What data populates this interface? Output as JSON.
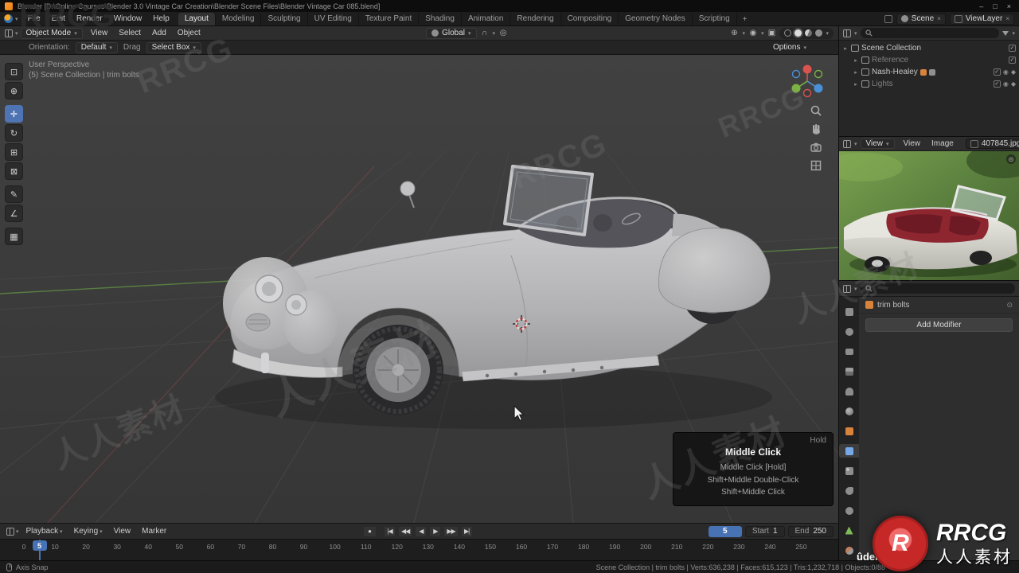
{
  "titlebar": {
    "title": "Blender [D:\\Online Courses\\Blender 3.0 Vintage Car Creation\\Blender Scene Files\\Blender Vintage Car 085.blend]",
    "minimize": "–",
    "maximize": "□",
    "close": "×"
  },
  "menubar": {
    "menus": [
      "File",
      "Edit",
      "Render",
      "Window",
      "Help"
    ],
    "workspaces": [
      "Layout",
      "Modeling",
      "Sculpting",
      "UV Editing",
      "Texture Paint",
      "Shading",
      "Animation",
      "Rendering",
      "Compositing",
      "Geometry Nodes",
      "Scripting"
    ],
    "active_workspace": "Layout",
    "new_workspace": "+",
    "scene_label": "Scene",
    "viewlayer_label": "ViewLayer",
    "unlink": "×"
  },
  "viewport_header": {
    "mode": "Object Mode",
    "menus": [
      "View",
      "Select",
      "Add",
      "Object"
    ],
    "orientation": "Global"
  },
  "tool_settings": {
    "orientation_label": "Orientation:",
    "orientation_value": "Default",
    "drag_label": "Drag",
    "drag_value": "Select Box",
    "options_label": "Options"
  },
  "viewport": {
    "overlay_line1": "User Perspective",
    "overlay_line2": "(5) Scene Collection | trim bolts",
    "tools": [
      {
        "name": "select-box-tool",
        "glyph": "⊡",
        "active": false
      },
      {
        "name": "cursor-tool",
        "glyph": "⊕",
        "active": false
      },
      {
        "name": "move-tool",
        "glyph": "✛",
        "active": true
      },
      {
        "name": "rotate-tool",
        "glyph": "↻",
        "active": false
      },
      {
        "name": "scale-tool",
        "glyph": "⊞",
        "active": false
      },
      {
        "name": "transform-tool",
        "glyph": "⊠",
        "active": false
      },
      {
        "name": "annotate-tool",
        "glyph": "✎",
        "active": false
      },
      {
        "name": "measure-tool",
        "glyph": "∠",
        "active": false
      },
      {
        "name": "add-cube-tool",
        "glyph": "▦",
        "active": false
      }
    ]
  },
  "tooltip": {
    "hold_label": "Hold",
    "title": "Middle Click",
    "lines": [
      "Middle Click [Hold]",
      "Shift+Middle Double-Click",
      "Shift+Middle Click"
    ]
  },
  "timeline": {
    "menus": [
      "Playback",
      "Keying",
      "View",
      "Marker"
    ],
    "record_glyph": "●",
    "transport": [
      "|◀",
      "◀◀",
      "◀",
      "▶",
      "▶▶",
      "▶|"
    ],
    "current_frame": "5",
    "start_label": "Start",
    "start_value": "1",
    "end_label": "End",
    "end_value": "250",
    "ticks": [
      0,
      10,
      20,
      30,
      40,
      50,
      60,
      70,
      80,
      90,
      100,
      110,
      120,
      130,
      140,
      150,
      160,
      170,
      180,
      190,
      200,
      210,
      220,
      230,
      240,
      250
    ]
  },
  "outliner": {
    "items": [
      {
        "label": "Scene Collection",
        "level": 0,
        "dim": false
      },
      {
        "label": "Reference",
        "level": 1,
        "dim": true
      },
      {
        "label": "Nash-Healey",
        "level": 1,
        "dim": false
      },
      {
        "label": "Lights",
        "level": 1,
        "dim": true
      }
    ]
  },
  "image_editor": {
    "mode": "View",
    "menus": [
      "View",
      "Image"
    ],
    "filename": "407845.jpg"
  },
  "properties": {
    "object_name": "trim bolts",
    "add_modifier_label": "Add Modifier",
    "tabs": [
      "tool",
      "render",
      "output",
      "view-layer",
      "scene",
      "world",
      "object",
      "modifiers",
      "particles",
      "physics",
      "constraints",
      "object-data",
      "material"
    ],
    "active_tab": "modifiers"
  },
  "statusbar": {
    "left": "Axis Snap",
    "stats": "Scene Collection | trim bolts | Verts:636,238 | Faces:615,123 | Tris:1,232,718 | Objects:0/88"
  },
  "branding": {
    "udemy": "ûdemy",
    "logo_text": "RRCG",
    "logo_subtext": "人人素材",
    "watermark_texts": [
      "RRCG",
      "人人素材"
    ]
  }
}
